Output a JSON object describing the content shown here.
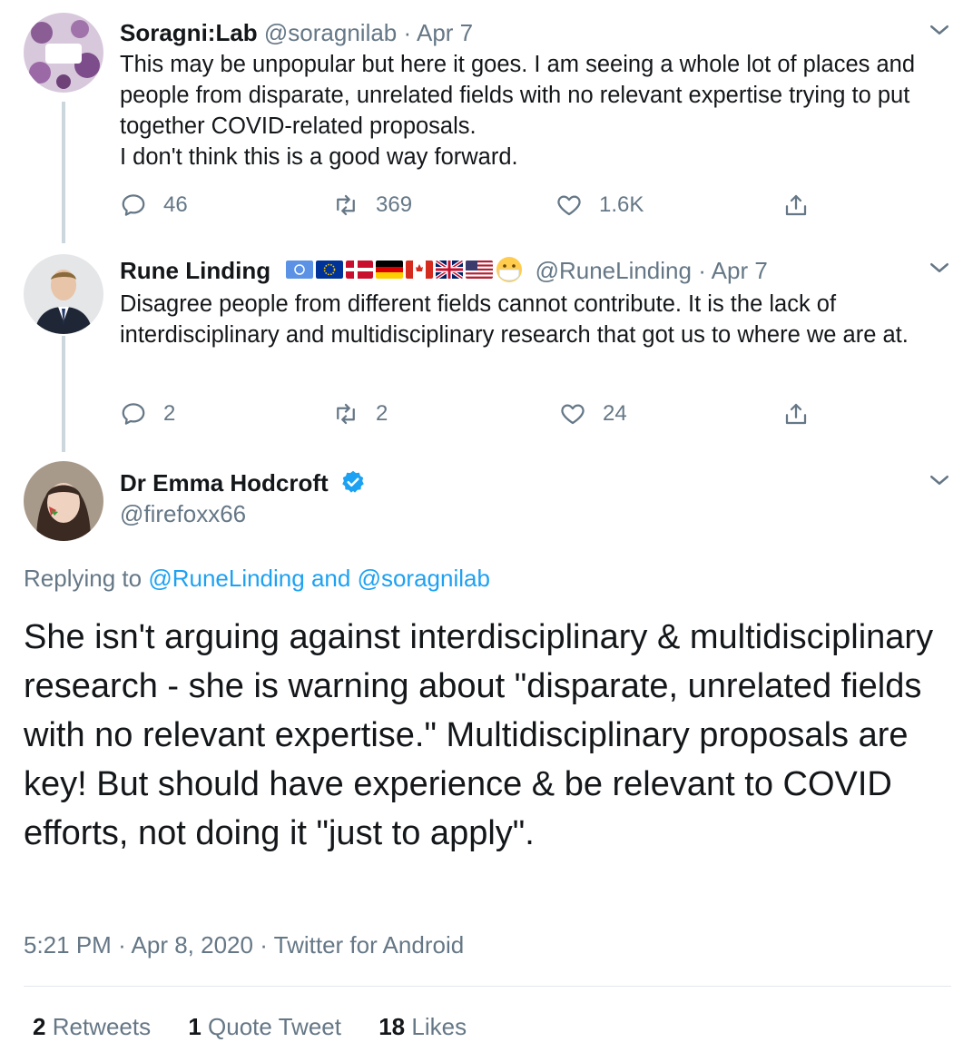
{
  "thread": [
    {
      "name": "Soragni:Lab",
      "handle": "@soragnilab",
      "date_sep": "·",
      "date": "Apr 7",
      "text": "This may be unpopular but here it goes. I am seeing a whole lot of places and people from disparate, unrelated fields with no relevant expertise trying to put together COVID-related proposals.\nI don't think this is a good way forward.",
      "replies": "46",
      "retweets": "369",
      "likes": "1.6K"
    },
    {
      "name": "Rune Linding",
      "handle": "@RuneLinding",
      "date_sep": "·",
      "date": "Apr 7",
      "flag_icons": [
        "un-flag-icon",
        "eu-flag-icon",
        "denmark-flag-icon",
        "germany-flag-icon",
        "canada-flag-icon",
        "uk-flag-icon",
        "usa-flag-icon",
        "face-mask-emoji-icon"
      ],
      "text": "Disagree people from different fields cannot contribute. It is the lack of interdisciplinary and multidisciplinary research that got us to where we are at.",
      "replies": "2",
      "retweets": "2",
      "likes": "24"
    }
  ],
  "main_tweet": {
    "name": "Dr Emma Hodcroft",
    "handle": "@firefoxx66",
    "replying_prefix": "Replying to",
    "replying_user1": "@RuneLinding",
    "replying_and": "and",
    "replying_user2": "@soragnilab",
    "text": "She isn't arguing against interdisciplinary & multidisciplinary research - she is warning about \"disparate, unrelated fields with no relevant expertise.\" Multidisciplinary proposals are key! But should have experience & be relevant to COVID efforts, not doing it \"just to apply\".",
    "time": "5:21 PM",
    "sep": "·",
    "date": "Apr 8, 2020",
    "source": "Twitter for Android",
    "retweets_count": "2",
    "retweets_label": "Retweets",
    "quote_count": "1",
    "quote_label": "Quote Tweet",
    "likes_count": "18",
    "likes_label": "Likes"
  },
  "colors": {
    "link": "#1da1f2",
    "secondary_text": "#657786",
    "verified": "#1da1f2",
    "thread_line": "#ccd6dd"
  }
}
